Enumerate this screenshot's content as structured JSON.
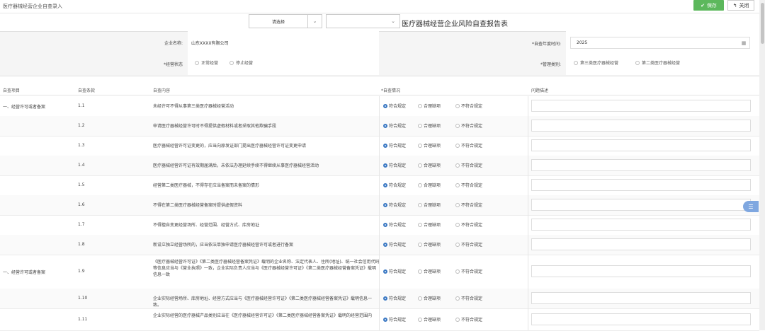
{
  "window": {
    "title": "医疗器械经营企业自查录入"
  },
  "toolbar": {
    "save_label": "保存",
    "close_label": "关闭"
  },
  "template_select": {
    "value": "请选择"
  },
  "report": {
    "title": "医疗器械经营企业风险自查报告表"
  },
  "form": {
    "company_label": "企业名称:",
    "company_value": "山东XXXX有限公司",
    "year_label": "*自查年度时间:",
    "year_value": "2025",
    "status_label": "*经营状态",
    "status_options": [
      "正常经营",
      "停止经营"
    ],
    "mgmt_label": "*管理类别:",
    "mgmt_options": [
      "第三类医疗器械经营",
      "第二类医疗器械经营"
    ]
  },
  "table": {
    "headers": [
      "自查项目",
      "自查条款",
      "自查内容",
      "*自查情况",
      "问题描述"
    ],
    "options": [
      "符合规定",
      "合理缺项",
      "不符合规定"
    ],
    "rows": [
      {
        "cat": "一、经营许可或者备案",
        "num": "1.1",
        "content": "未经许可不得从事第三类医疗器械经营活动"
      },
      {
        "cat": "",
        "num": "1.2",
        "content": "申请医疗器械经营许可时不得提供虚假材料或者采取其他欺骗手段"
      },
      {
        "cat": "",
        "num": "1.3",
        "content": "医疗器械经营许可证变更的，应当向原发证部门提出医疗器械经营许可证变更申请"
      },
      {
        "cat": "",
        "num": "1.4",
        "content": "医疗器械经营许可证有效期届满后，未依法办理延续手续不得继续从事医疗器械经营活动"
      },
      {
        "cat": "",
        "num": "1.5",
        "content": "经营第二类医疗器械，不得存在应当备案而未备案的情形"
      },
      {
        "cat": "",
        "num": "1.6",
        "content": "不得在第二类医疗器械经营备案时提供虚假资料"
      },
      {
        "cat": "",
        "num": "1.7",
        "content": "不得擅自变更经营场所、经营范围、经营方式、库房地址"
      },
      {
        "cat": "",
        "num": "1.8",
        "content": "新设立独立经营场所的，应当依法单独申请医疗器械经营许可或者进行备案"
      },
      {
        "cat": "一、经营许可或者备案",
        "num": "1.9",
        "content": "《医疗器械经营许可证》《第二类医疗器械经营备案凭证》载明的企业名称、法定代表人、住所(地址)、统一社会信用代码等信息应当与《营业执照》一致，企业实际负责人应当与《医疗器械经营许可证》《第二类医疗器械经营备案凭证》载明信息一致"
      },
      {
        "cat": "",
        "num": "1.10",
        "content": "企业实际经营场所、库房地址、经营方式应当与《医疗器械经营许可证》《第二类医疗器械经营备案凭证》载明信息一致。"
      },
      {
        "cat": "",
        "num": "1.11",
        "content": "企业实际经营的医疗器械产品类别应当在《医疗器械经营许可证》《第二类医疗器械经营备案凭证》载明的经营范围内"
      }
    ]
  }
}
